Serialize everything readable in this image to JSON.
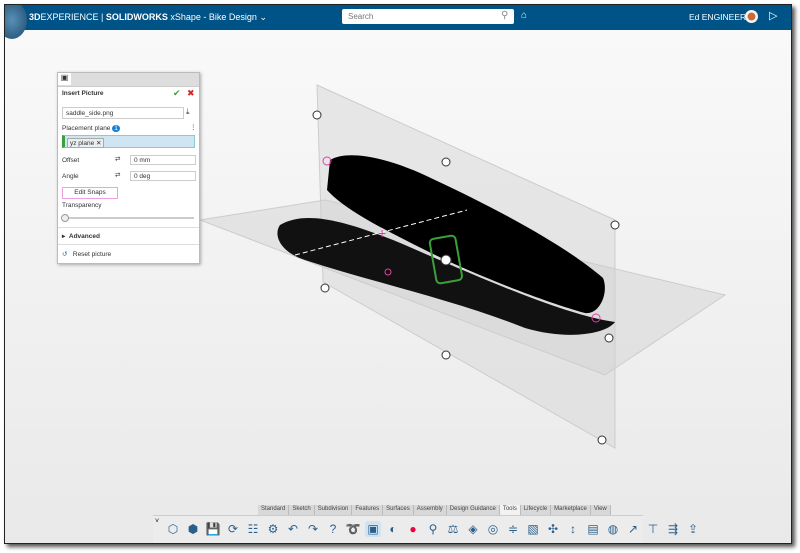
{
  "header": {
    "brand_prefix": "3D",
    "brand_main": "EXPERIENCE | ",
    "brand_sw": "SOLIDWORKS",
    "app": " xShape - Bike Design",
    "search_placeholder": "Search",
    "user": "Ed ENGINEER"
  },
  "panel": {
    "title": "Insert Picture",
    "file": "saddle_side.png",
    "placement_label": "Placement plane",
    "placement_badge": "1",
    "plane": "yz plane",
    "offset_label": "Offset",
    "offset_value": "0 mm",
    "angle_label": "Angle",
    "angle_value": "0 deg",
    "edit_snaps": "Edit Snaps",
    "transparency_label": "Transparency",
    "transparency_value": 0,
    "advanced": "Advanced",
    "reset": "Reset picture"
  },
  "tabs": [
    {
      "label": "Standard"
    },
    {
      "label": "Sketch"
    },
    {
      "label": "Subdivision"
    },
    {
      "label": "Features"
    },
    {
      "label": "Surfaces"
    },
    {
      "label": "Assembly"
    },
    {
      "label": "Design Guidance"
    },
    {
      "label": "Tools",
      "active": true
    },
    {
      "label": "Lifecycle"
    },
    {
      "label": "Marketplace"
    },
    {
      "label": "View"
    }
  ],
  "tools": [
    "part-icon",
    "solid-icon",
    "save-icon",
    "refresh-icon",
    "properties-icon",
    "settings-icon",
    "undo-icon",
    "redo-icon",
    "help-icon",
    "lasso-icon",
    "insert-picture-icon",
    "render-icon",
    "color-wheel-icon",
    "measure-icon",
    "balance-icon",
    "section-icon",
    "inspect-icon",
    "align-icon",
    "zebra-icon",
    "snap-icon",
    "distance-icon",
    "mass-icon",
    "globe-icon",
    "share-icon",
    "filter-icon",
    "export-icon",
    "publish-icon"
  ],
  "colors": {
    "header": "#005386",
    "accent": "#e040a0",
    "snap": "#3aa03a"
  }
}
